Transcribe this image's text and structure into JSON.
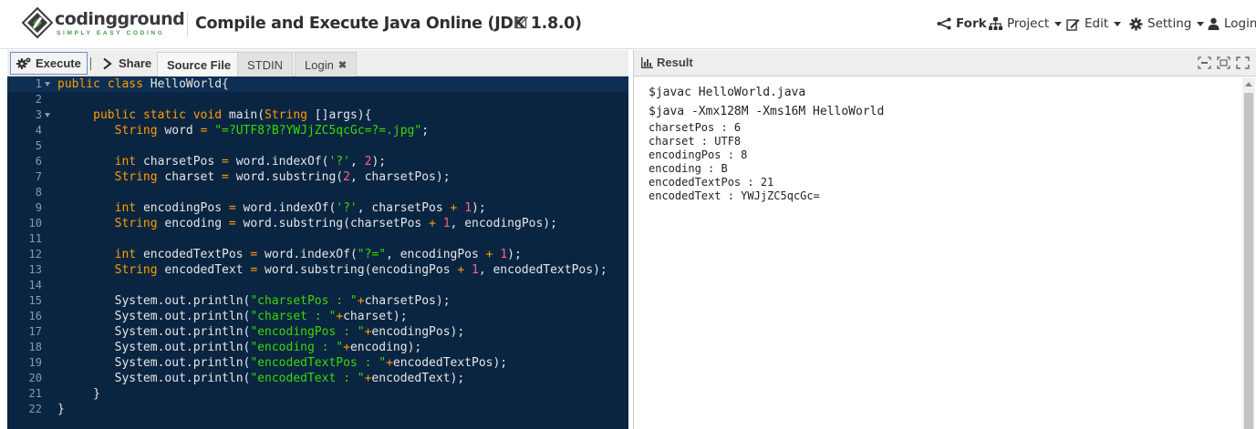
{
  "header": {
    "logo_name": "codingground",
    "logo_tagline": "SIMPLY EASY CODING",
    "title": "Compile and Execute Java Online (JDK 1.8.0)",
    "nav": {
      "fork": "Fork",
      "project": "Project",
      "edit": "Edit",
      "setting": "Setting",
      "login": "Login"
    }
  },
  "toolbar": {
    "execute": "Execute",
    "share": "Share",
    "tabs": {
      "source_file": "Source File",
      "stdin": "STDIN",
      "login": "Login"
    }
  },
  "editor": {
    "line_numbers": [
      "1",
      "2",
      "3",
      "4",
      "5",
      "6",
      "7",
      "8",
      "9",
      "10",
      "11",
      "12",
      "13",
      "14",
      "15",
      "16",
      "17",
      "18",
      "19",
      "20",
      "21",
      "22"
    ],
    "lines": [
      "public class HelloWorld{",
      "",
      "     public static void main(String []args){",
      "        String word = \"=?UTF8?B?YWJjZC5qcGc=?=.jpg\";",
      "",
      "        int charsetPos = word.indexOf('?', 2);",
      "        String charset = word.substring(2, charsetPos);",
      "",
      "        int encodingPos = word.indexOf('?', charsetPos + 1);",
      "        String encoding = word.substring(charsetPos + 1, encodingPos);",
      "",
      "        int encodedTextPos = word.indexOf(\"?=\", encodingPos + 1);",
      "        String encodedText = word.substring(encodingPos + 1, encodedTextPos);",
      "",
      "        System.out.println(\"charsetPos : \"+charsetPos);",
      "        System.out.println(\"charset : \"+charset);",
      "        System.out.println(\"encodingPos : \"+encodingPos);",
      "        System.out.println(\"encoding : \"+encoding);",
      "        System.out.println(\"encodedTextPos : \"+encodedTextPos);",
      "        System.out.println(\"encodedText : \"+encodedText);",
      "     }",
      "}"
    ]
  },
  "result": {
    "title": "Result",
    "commands": [
      "$javac HelloWorld.java",
      "$java -Xmx128M -Xms16M HelloWorld"
    ],
    "output": [
      "charsetPos : 6",
      "charset : UTF8",
      "encodingPos : 8",
      "encoding : B",
      "encodedTextPos : 21",
      "encodedText : YWJjZC5qcGc="
    ]
  },
  "colors": {
    "editor_bg": "#0a2542",
    "keyword": "#ff9d00",
    "string": "#3ad900",
    "number": "#ff628c",
    "logo_green": "#4a9a4a"
  }
}
